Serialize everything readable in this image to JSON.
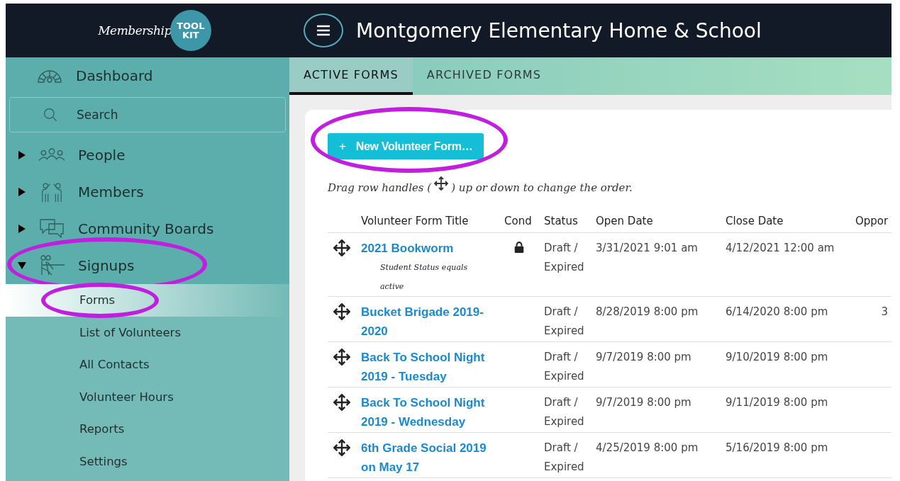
{
  "header": {
    "logo_script": "Membership",
    "logo_badge": [
      "TOOL",
      "KIT"
    ],
    "title": "Montgomery Elementary Home & School"
  },
  "sidebar": {
    "items": [
      {
        "kind": "link",
        "label": "Dashboard"
      },
      {
        "kind": "search",
        "label": "Search"
      },
      {
        "kind": "group",
        "label": "People",
        "expanded": false,
        "circled": false
      },
      {
        "kind": "group",
        "label": "Members",
        "expanded": false,
        "circled": false
      },
      {
        "kind": "group",
        "label": "Community Boards",
        "expanded": false,
        "circled": false
      },
      {
        "kind": "group",
        "label": "Signups",
        "expanded": true,
        "circled": true,
        "children": [
          {
            "label": "Forms",
            "selected": true,
            "circled": true
          },
          {
            "label": "List of Volunteers",
            "selected": false,
            "circled": false
          },
          {
            "label": "All Contacts",
            "selected": false,
            "circled": false
          },
          {
            "label": "Volunteer Hours",
            "selected": false,
            "circled": false
          },
          {
            "label": "Reports",
            "selected": false,
            "circled": false
          },
          {
            "label": "Settings",
            "selected": false,
            "circled": false
          }
        ]
      }
    ]
  },
  "tabs": [
    {
      "label": "ACTIVE FORMS",
      "selected": true
    },
    {
      "label": "ARCHIVED FORMS",
      "selected": false
    }
  ],
  "new_button": {
    "icon_text": "+",
    "label": "New Volunteer Form…",
    "circled": true
  },
  "hint": {
    "before": "Drag row handles (",
    "after": ") up or down to change the order."
  },
  "table": {
    "columns": [
      "Volunteer Form Title",
      "Cond",
      "Status",
      "Open Date",
      "Close Date",
      "Oppor"
    ],
    "rows": [
      {
        "title": "2021 Bookworm",
        "condition": "Student Status equals active",
        "locked": true,
        "status": "Draft / Expired",
        "open_date": "3/31/2021 9:01 am",
        "close_date": "4/12/2021 12:00 am"
      },
      {
        "title": "Bucket Brigade 2019-2020",
        "locked": false,
        "status": "Draft / Expired",
        "open_date": "8/28/2019 8:00 pm",
        "close_date": "6/14/2020 8:00 pm",
        "column_6": "3"
      },
      {
        "title": "Back To School Night 2019 - Tuesday",
        "locked": false,
        "status": "Draft / Expired",
        "open_date": "9/7/2019 8:00 pm",
        "close_date": "9/10/2019 8:00 pm"
      },
      {
        "title": "Back To School Night 2019 - Wednesday",
        "locked": false,
        "status": "Draft / Expired",
        "open_date": "9/7/2019 8:00 pm",
        "close_date": "9/11/2019 8:00 pm"
      },
      {
        "title": "6th Grade Social 2019 on May 17",
        "locked": false,
        "status": "Draft / Expired",
        "open_date": "4/25/2019 8:00 pm",
        "close_date": "5/16/2019 8:00 pm"
      }
    ]
  }
}
